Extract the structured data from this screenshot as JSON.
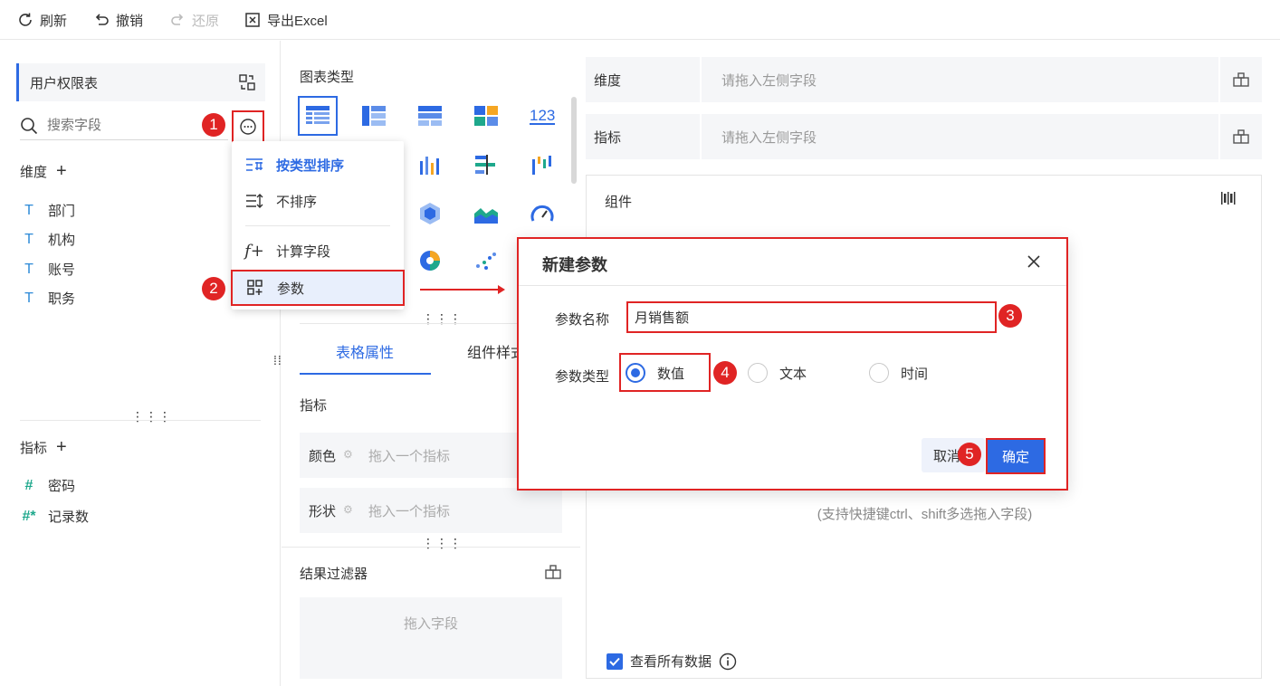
{
  "toolbar": {
    "refresh": "刷新",
    "undo": "撤销",
    "redo": "还原",
    "export": "导出Excel"
  },
  "left": {
    "table_name": "用户权限表",
    "search_placeholder": "搜索字段",
    "dimension_title": "维度",
    "dimension_fields": [
      "部门",
      "机构",
      "账号",
      "职务"
    ],
    "measure_title": "指标",
    "measure_fields": [
      "密码",
      "记录数"
    ]
  },
  "menu": {
    "sort_by_type": "按类型排序",
    "no_sort": "不排序",
    "calc_field": "计算字段",
    "param": "参数"
  },
  "middle": {
    "chart_type_title": "图表类型",
    "tab_table_props": "表格属性",
    "tab_component_style": "组件样式",
    "measure_label": "指标",
    "color_label": "颜色",
    "color_placeholder": "拖入一个指标",
    "shape_label": "形状",
    "shape_placeholder": "拖入一个指标",
    "filter_title": "结果过滤器",
    "filter_placeholder": "拖入字段"
  },
  "right": {
    "dimension_label": "维度",
    "dimension_placeholder": "请拖入左侧字段",
    "measure_label": "指标",
    "measure_placeholder": "请拖入左侧字段",
    "component_title": "组件",
    "hint": "(支持快捷键ctrl、shift多选拖入字段)",
    "view_all": "查看所有数据"
  },
  "dialog": {
    "title": "新建参数",
    "name_label": "参数名称",
    "name_value": "月销售额",
    "type_label": "参数类型",
    "type_options": [
      "数值",
      "文本",
      "时间"
    ],
    "selected_type": "数值",
    "cancel": "取消",
    "ok": "确定"
  },
  "badges": [
    "1",
    "2",
    "3",
    "4",
    "5"
  ],
  "colors": {
    "accent": "#2d6ae3",
    "highlight": "#e02424"
  }
}
